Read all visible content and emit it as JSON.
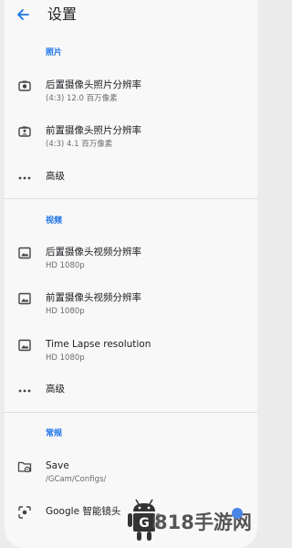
{
  "header": {
    "title": "设置",
    "back_icon": "arrow-left-icon"
  },
  "sections": [
    {
      "header": "照片",
      "items": [
        {
          "title": "后置摄像头照片分辨率",
          "subtitle": "(4:3) 12.0 百万像素",
          "icon": "rear-camera-icon"
        },
        {
          "title": "前置摄像头照片分辨率",
          "subtitle": "(4:3) 4.1 百万像素",
          "icon": "front-camera-icon"
        },
        {
          "title": "高级",
          "icon": "more-dots-icon"
        }
      ]
    },
    {
      "header": "视频",
      "items": [
        {
          "title": "后置摄像头视频分辨率",
          "subtitle": "HD 1080p",
          "icon": "video-camera-icon"
        },
        {
          "title": "前置摄像头视频分辨率",
          "subtitle": "HD 1080p",
          "icon": "video-camera-icon"
        },
        {
          "title": "Time Lapse resolution",
          "subtitle": "HD 1080p",
          "icon": "video-camera-icon"
        },
        {
          "title": "高级",
          "icon": "more-dots-icon"
        }
      ]
    },
    {
      "header": "常规",
      "items": [
        {
          "title": "Save",
          "subtitle": "/GCam/Configs/",
          "icon": "folder-settings-icon"
        },
        {
          "title": "Google 智能镜头",
          "icon": "lens-icon"
        }
      ]
    }
  ],
  "watermark": {
    "text": "818手游网",
    "letter": "G"
  },
  "colors": {
    "accent": "#1a73e8",
    "background": "#f8f8f9",
    "text": "#202124",
    "subtext": "#6b6b6b"
  }
}
